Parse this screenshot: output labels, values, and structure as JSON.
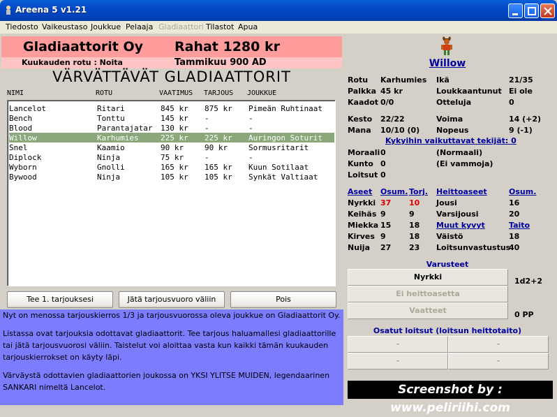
{
  "window": {
    "title": "Areena 5 v1.21"
  },
  "menu": [
    "Tiedosto",
    "Vaikeustaso",
    "Joukkue",
    "Pelaaja",
    "Gladiaattori",
    "Tilastot",
    "Apua"
  ],
  "header": {
    "team": "Gladiaattorit Oy",
    "money": "Rahat 1280 kr",
    "race_label": "Kuukauden rotu : Noita",
    "date": "Tammikuu 900 AD"
  },
  "page_title": "VÄRVÄTTÄVÄT GLADIAATTORIT",
  "columns": [
    "NIMI",
    "ROTU",
    "VAATIMUS",
    "TARJOUS",
    "JOUKKUE"
  ],
  "rows": [
    [
      "Lancelot",
      "Ritari",
      "845 kr",
      "875 kr",
      "Pimeän Ruhtinaat"
    ],
    [
      "Bench",
      "Tonttu",
      "145 kr",
      "-",
      "-"
    ],
    [
      "Blood",
      "Parantajatar",
      "130 kr",
      "-",
      "-"
    ],
    [
      "Willow",
      "Karhumies",
      "225 kr",
      "225 kr",
      "Auringon Soturit"
    ],
    [
      "Snel",
      "Kaamio",
      "90 kr",
      "90 kr",
      "Sormusritarit"
    ],
    [
      "Diplock",
      "Ninja",
      "75 kr",
      "-",
      "-"
    ],
    [
      "Wyborn",
      "Gnolli",
      "165 kr",
      "165 kr",
      "Kuun Sotilaat"
    ],
    [
      "Bywood",
      "Ninja",
      "105 kr",
      "105 kr",
      "Synkät Valtiaat"
    ]
  ],
  "buttons": {
    "offer": "Tee 1. tarjouksesi",
    "skip": "Jätä tarjousvuoro väliin",
    "exit": "Pois"
  },
  "messages": [
    "Nyt on menossa tarjouskierros 1/3 ja tarjousvuorossa oleva joukkue on Gladiaattorit Oy.",
    "Listassa ovat tarjouksia odottavat gladiaattorit. Tee tarjous haluamallesi gladiaattorille tai jätä tarjousvuorosi väliin. Taistelut voi aloittaa vasta kun kaikki tämän kuukauden tarjouskierrokset on käyty läpi.",
    "Värväystä odottavien gladiaattorien joukossa on YKSI YLITSE MUIDEN, legendaarinen SANKARI nimeltä Lancelot."
  ],
  "gladiator": {
    "name": "Willow",
    "rotu_label": "Rotu",
    "rotu": "Karhumies",
    "ika_label": "Ikä",
    "ika": "21/35",
    "palkka_label": "Palkka",
    "palkka": "45 kr",
    "loukkaantunut_label": "Loukkaantunut",
    "loukkaantunut": "Ei ole",
    "kaadot_label": "Kaadot",
    "kaadot": "0/0",
    "otteluja_label": "Otteluja",
    "otteluja": "0",
    "kesto_label": "Kesto",
    "kesto": "22/22",
    "voima_label": "Voima",
    "voima": "14 (+2)",
    "mana_label": "Mana",
    "mana": "10/10 (0)",
    "nopeus_label": "Nopeus",
    "nopeus": "9 (-1)",
    "factors_link": "Kykyihin vaikuttavat tekijät: 0",
    "moraali_label": "Moraali",
    "moraali": "0",
    "moraali_note": "(Normaali)",
    "kunto_label": "Kunto",
    "kunto": "0",
    "kunto_note": "(Ei vammoja)",
    "loitsut_label": "Loitsut",
    "loitsut": "0"
  },
  "weapons": {
    "headers": [
      "Aseet",
      "Osum.",
      "Torj."
    ],
    "rows": [
      [
        "Nyrkki",
        "37",
        "10"
      ],
      [
        "Keihäs",
        "9",
        "9"
      ],
      [
        "Miekka",
        "15",
        "18"
      ],
      [
        "Kirves",
        "9",
        "18"
      ],
      [
        "Nuija",
        "27",
        "23"
      ]
    ]
  },
  "throwing": {
    "headers": [
      "Heittoaseet",
      "Osum."
    ],
    "rows": [
      [
        "Jousi",
        "16"
      ],
      [
        "Varsijousi",
        "20"
      ]
    ]
  },
  "other_skills": {
    "headers": [
      "Muut kyvyt",
      "Taito"
    ],
    "rows": [
      [
        "Väistö",
        "18"
      ],
      [
        "Loitsunvastustus",
        "40"
      ]
    ]
  },
  "equipment": {
    "title": "Varusteet",
    "weapon": "Nyrkki",
    "damage": "1d2+2",
    "throwing": "Ei heittoasetta",
    "armor": "Vaatteet",
    "armor_value": "0 PP"
  },
  "spells": {
    "title": "Osatut loitsut (loitsun heittotaito)",
    "slots": [
      "-",
      "-",
      "-",
      "-"
    ]
  },
  "watermark": "Screenshot by : www.peliriihi.com",
  "colors": {
    "header_red": "#ff9c9c",
    "header_pink": "#ffc4c4",
    "selection": "#8ba87a",
    "message_bg": "#7c7cff",
    "link_blue": "#0000a0",
    "stat_red": "#e00000"
  }
}
